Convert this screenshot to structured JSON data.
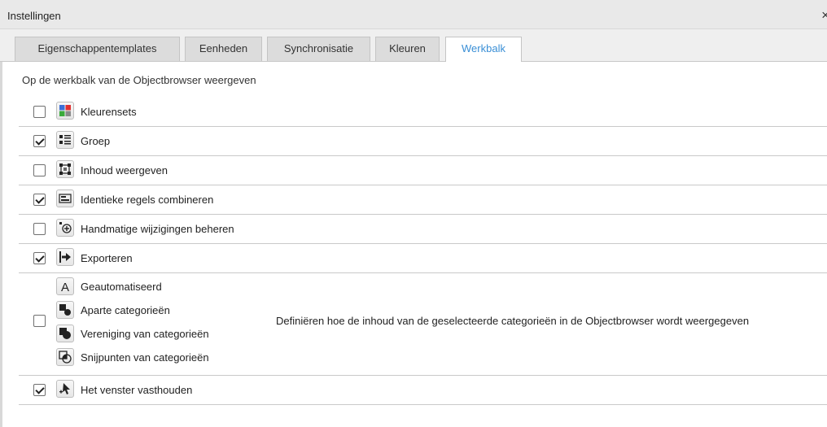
{
  "window": {
    "title": "Instellingen",
    "close_glyph": "×"
  },
  "tabs": [
    {
      "label": "Eigenschappentemplates"
    },
    {
      "label": "Eenheden"
    },
    {
      "label": "Synchronisatie"
    },
    {
      "label": "Kleuren"
    },
    {
      "label": "Werkbalk",
      "active": true
    }
  ],
  "colors": {
    "accent": "#3a8fd6"
  },
  "section": {
    "heading": "Op de werkbalk van de Objectbrowser weergeven"
  },
  "options": [
    {
      "label": "Kleurensets",
      "checked": false,
      "icon": "color-sets-icon"
    },
    {
      "label": "Groep",
      "checked": true,
      "icon": "group-icon"
    },
    {
      "label": "Inhoud weergeven",
      "checked": false,
      "icon": "show-content-icon"
    },
    {
      "label": "Identieke regels combineren",
      "checked": true,
      "icon": "combine-rows-icon"
    },
    {
      "label": "Handmatige wijzigingen beheren",
      "checked": false,
      "icon": "manage-changes-icon"
    },
    {
      "label": "Exporteren",
      "checked": true,
      "icon": "export-icon"
    }
  ],
  "category_group": {
    "checked": false,
    "items": [
      {
        "label": "Geautomatiseerd",
        "icon": "automatic-icon"
      },
      {
        "label": "Aparte categorieën",
        "icon": "separate-categories-icon"
      },
      {
        "label": "Vereniging van categorieën",
        "icon": "union-categories-icon"
      },
      {
        "label": "Snijpunten van categorieën",
        "icon": "intersection-categories-icon"
      }
    ],
    "description": "Definiëren hoe de inhoud van de geselecteerde categorieën in de Objectbrowser wordt weergegeven"
  },
  "keep_window": {
    "label": "Het venster vasthouden",
    "checked": true,
    "icon": "pin-window-icon"
  }
}
